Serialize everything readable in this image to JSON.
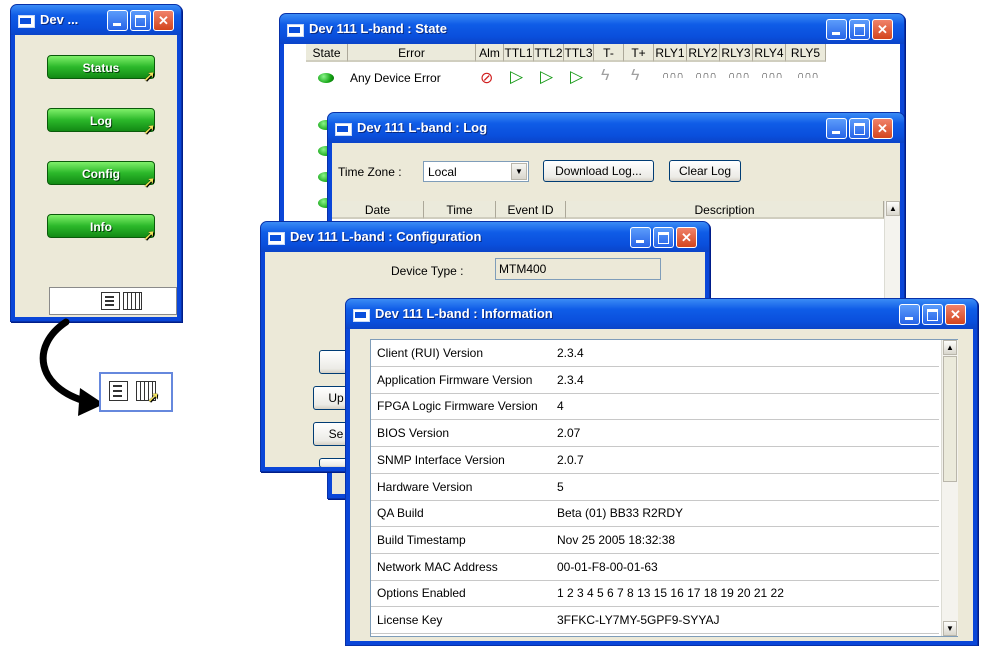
{
  "launcher": {
    "title": "Dev ...",
    "buttons": [
      "Status",
      "Log",
      "Config",
      "Info"
    ]
  },
  "state": {
    "title": "Dev 111 L-band : State",
    "columns": [
      "State",
      "Error",
      "Alm",
      "TTL1",
      "TTL2",
      "TTL3",
      "T-",
      "T+",
      "RLY1",
      "RLY2",
      "RLY3",
      "RLY4",
      "RLY5"
    ],
    "row_label": "Any Device Error"
  },
  "log": {
    "title": "Dev 111 L-band : Log",
    "timezone_label": "Time Zone :",
    "timezone_value": "Local",
    "download_label": "Download Log...",
    "clear_label": "Clear Log",
    "columns": [
      "Date",
      "Time",
      "Event ID",
      "Description"
    ]
  },
  "config": {
    "title": "Dev 111 L-band : Configuration",
    "device_type_label": "Device Type :",
    "device_type_value": "MTM400",
    "partial_labels": [
      "Up",
      "Se"
    ]
  },
  "info": {
    "title": "Dev 111 L-band : Information",
    "rows": [
      {
        "key": "Client (RUI) Version",
        "value": "2.3.4"
      },
      {
        "key": "Application Firmware Version",
        "value": "2.3.4"
      },
      {
        "key": "FPGA Logic Firmware Version",
        "value": "4"
      },
      {
        "key": "BIOS Version",
        "value": "2.07"
      },
      {
        "key": "SNMP Interface Version",
        "value": "2.0.7"
      },
      {
        "key": "Hardware Version",
        "value": "5"
      },
      {
        "key": "QA Build",
        "value": "Beta (01) BB33 R2RDY"
      },
      {
        "key": "Build Timestamp",
        "value": "Nov 25 2005 18:32:38"
      },
      {
        "key": "Network MAC Address",
        "value": "00-01-F8-00-01-63"
      },
      {
        "key": "Options Enabled",
        "value": "1 2 3 4 5 6 7 8 13 15 16 17 18 19 20 21 22"
      },
      {
        "key": "License Key",
        "value": "3FFKC-LY7MY-5GPF9-SYYAJ"
      }
    ]
  },
  "colors": {
    "titlebar": "#0a4fdc",
    "window_bg": "#ece9d8",
    "led_green": "#14a414",
    "alarm_red": "#d02020",
    "green_button": "#2bb82a"
  }
}
